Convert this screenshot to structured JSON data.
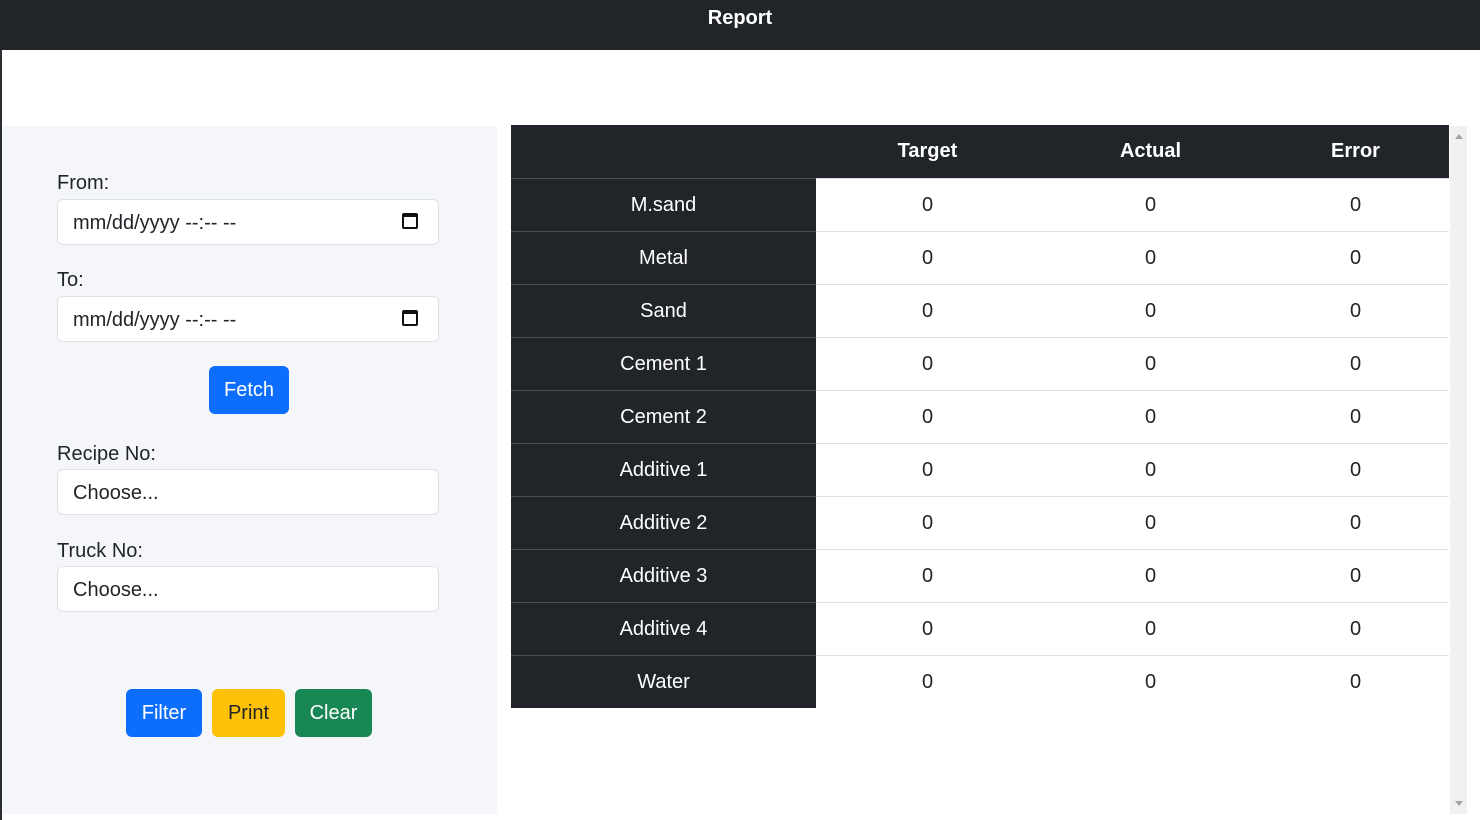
{
  "header": {
    "title": "Report"
  },
  "filters": {
    "from_label": "From:",
    "from_value": "mm/dd/yyyy --:-- --",
    "to_label": "To:",
    "to_value": "mm/dd/yyyy --:-- --",
    "fetch_label": "Fetch",
    "recipe_label": "Recipe No:",
    "recipe_value": "Choose...",
    "truck_label": "Truck No:",
    "truck_value": "Choose...",
    "filter_label": "Filter",
    "print_label": "Print",
    "clear_label": "Clear"
  },
  "table": {
    "columns": [
      "",
      "Target",
      "Actual",
      "Error"
    ],
    "rows": [
      {
        "name": "M.sand",
        "target": "0",
        "actual": "0",
        "error": "0"
      },
      {
        "name": "Metal",
        "target": "0",
        "actual": "0",
        "error": "0"
      },
      {
        "name": "Sand",
        "target": "0",
        "actual": "0",
        "error": "0"
      },
      {
        "name": "Cement 1",
        "target": "0",
        "actual": "0",
        "error": "0"
      },
      {
        "name": "Cement 2",
        "target": "0",
        "actual": "0",
        "error": "0"
      },
      {
        "name": "Additive 1",
        "target": "0",
        "actual": "0",
        "error": "0"
      },
      {
        "name": "Additive 2",
        "target": "0",
        "actual": "0",
        "error": "0"
      },
      {
        "name": "Additive 3",
        "target": "0",
        "actual": "0",
        "error": "0"
      },
      {
        "name": "Additive 4",
        "target": "0",
        "actual": "0",
        "error": "0"
      },
      {
        "name": "Water",
        "target": "0",
        "actual": "0",
        "error": "0"
      }
    ]
  },
  "icons": {
    "date_picker": "calendar-icon"
  },
  "colors": {
    "header_bg": "#212529",
    "primary": "#0d6efd",
    "warning": "#ffc107",
    "success": "#198754",
    "panel_bg": "#f5f6fa"
  }
}
